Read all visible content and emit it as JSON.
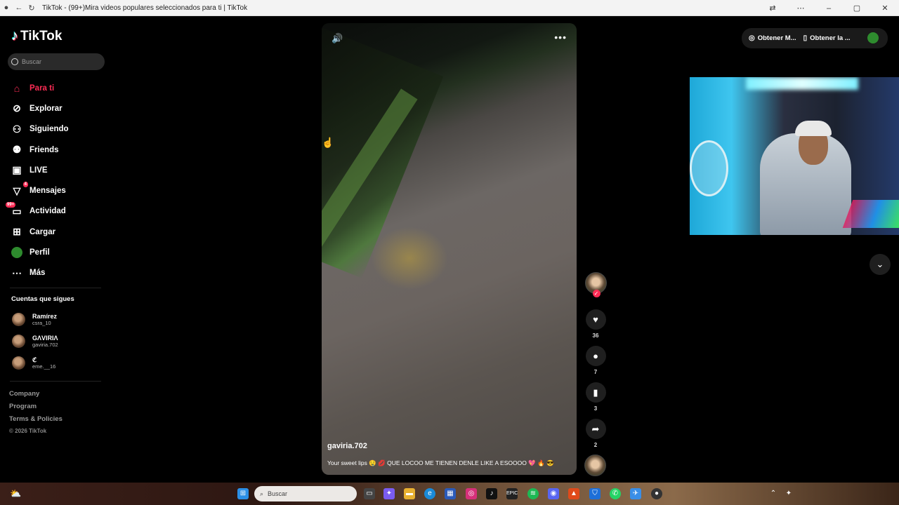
{
  "window": {
    "title": "TikTok - (99+)Mira videos populares seleccionados para ti | TikTok"
  },
  "app": {
    "logo": "TikTok"
  },
  "search": {
    "placeholder": "Buscar"
  },
  "nav": [
    {
      "label": "Para ti",
      "icon": "home-icon",
      "active": true
    },
    {
      "label": "Explorar",
      "icon": "compass-icon"
    },
    {
      "label": "Siguiendo",
      "icon": "following-icon"
    },
    {
      "label": "Friends",
      "icon": "friends-icon"
    },
    {
      "label": "LIVE",
      "icon": "live-icon"
    },
    {
      "label": "Mensajes",
      "icon": "messages-icon",
      "badge": "4"
    },
    {
      "label": "Actividad",
      "icon": "activity-icon",
      "badge": "99+"
    },
    {
      "label": "Cargar",
      "icon": "upload-icon"
    },
    {
      "label": "Perfil",
      "icon": "profile-avatar"
    },
    {
      "label": "Más",
      "icon": "more-icon"
    }
  ],
  "following": {
    "heading": "Cuentas que sigues",
    "accounts": [
      {
        "name": "Ramírez",
        "handle": "csra_10"
      },
      {
        "name": "GΛVIRIΛ",
        "handle": "gaviria.702"
      },
      {
        "name": "ℭ",
        "handle": "eme.__16"
      }
    ]
  },
  "footer": {
    "links": [
      "Company",
      "Program",
      "Terms & Policies"
    ],
    "copyright": "© 2026 TikTok"
  },
  "video": {
    "author": "gaviria.702",
    "caption": "Your sweet lips 🤤 💋 QUE LOCOO ME TIENEN DENLE LIKE A ESOOOO 💖 🔥 😎"
  },
  "actions": {
    "likes": "36",
    "comments": "7",
    "saves": "3",
    "shares": "2"
  },
  "header": {
    "btn_coins": "Obtener M...",
    "btn_app": "Obtener la ..."
  },
  "taskbar": {
    "search_placeholder": "Buscar"
  }
}
